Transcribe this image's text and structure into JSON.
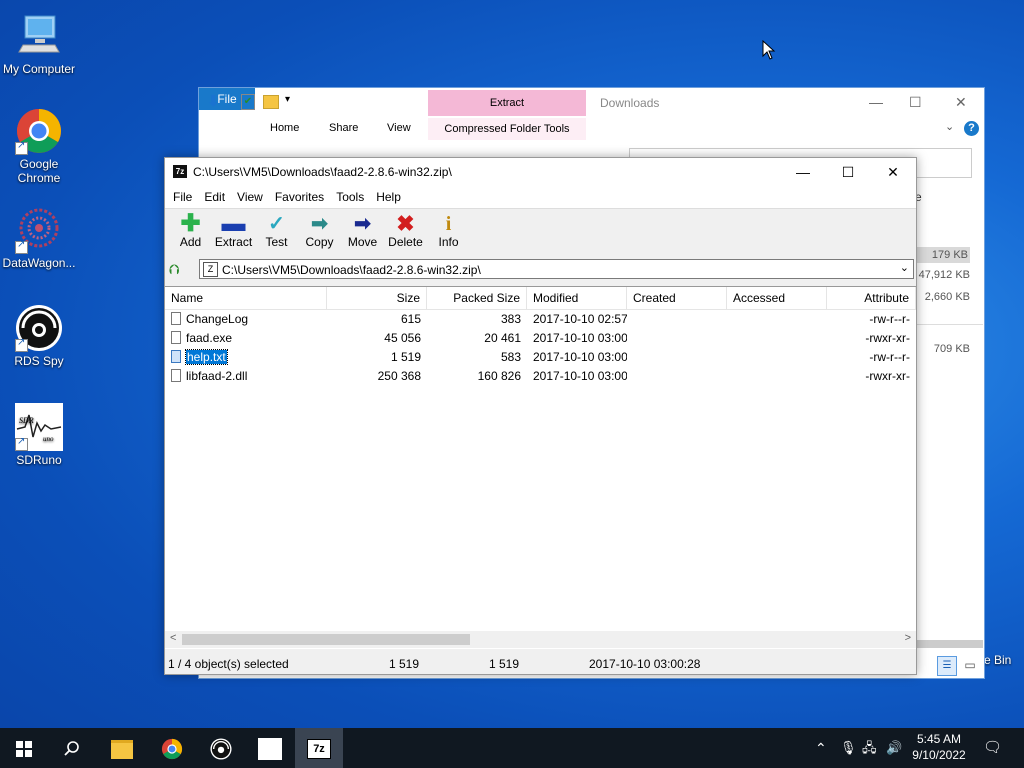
{
  "desktop": {
    "icons": [
      {
        "label": "My Computer"
      },
      {
        "label": "Google Chrome"
      },
      {
        "label": "DataWagon..."
      },
      {
        "label": "RDS Spy"
      },
      {
        "label": "SDRuno"
      }
    ],
    "recycle_bin_partial": "e Bin"
  },
  "explorer": {
    "title": "Downloads",
    "tabs": {
      "file": "File",
      "home": "Home",
      "share": "Share",
      "view": "View"
    },
    "context_header": "Extract",
    "context_tab": "Compressed Folder Tools",
    "partial_label": "e",
    "sizes": [
      "179 KB",
      "47,912 KB",
      "2,660 KB",
      "709 KB"
    ]
  },
  "sevenzip": {
    "title": "C:\\Users\\VM5\\Downloads\\faad2-2.8.6-win32.zip\\",
    "menu": [
      "File",
      "Edit",
      "View",
      "Favorites",
      "Tools",
      "Help"
    ],
    "toolbar": {
      "add": "Add",
      "extract": "Extract",
      "test": "Test",
      "copy": "Copy",
      "move": "Move",
      "delete": "Delete",
      "info": "Info"
    },
    "address": "C:\\Users\\VM5\\Downloads\\faad2-2.8.6-win32.zip\\",
    "columns": {
      "name": "Name",
      "size": "Size",
      "packed": "Packed Size",
      "modified": "Modified",
      "created": "Created",
      "accessed": "Accessed",
      "attributes": "Attribute"
    },
    "files": [
      {
        "name": "ChangeLog",
        "size": "615",
        "packed": "383",
        "modified": "2017-10-10 02:57",
        "created": "",
        "accessed": "",
        "attr": "-rw-r--r-"
      },
      {
        "name": "faad.exe",
        "size": "45 056",
        "packed": "20 461",
        "modified": "2017-10-10 03:00",
        "created": "",
        "accessed": "",
        "attr": "-rwxr-xr-"
      },
      {
        "name": "help.txt",
        "size": "1 519",
        "packed": "583",
        "modified": "2017-10-10 03:00",
        "created": "",
        "accessed": "",
        "attr": "-rw-r--r-"
      },
      {
        "name": "libfaad-2.dll",
        "size": "250 368",
        "packed": "160 826",
        "modified": "2017-10-10 03:00",
        "created": "",
        "accessed": "",
        "attr": "-rwxr-xr-"
      }
    ],
    "status": {
      "selected": "1 / 4 object(s) selected",
      "size": "1 519",
      "packed": "1 519",
      "modified": "2017-10-10 03:00:28"
    }
  },
  "taskbar": {
    "time": "5:45 AM",
    "date": "9/10/2022"
  }
}
